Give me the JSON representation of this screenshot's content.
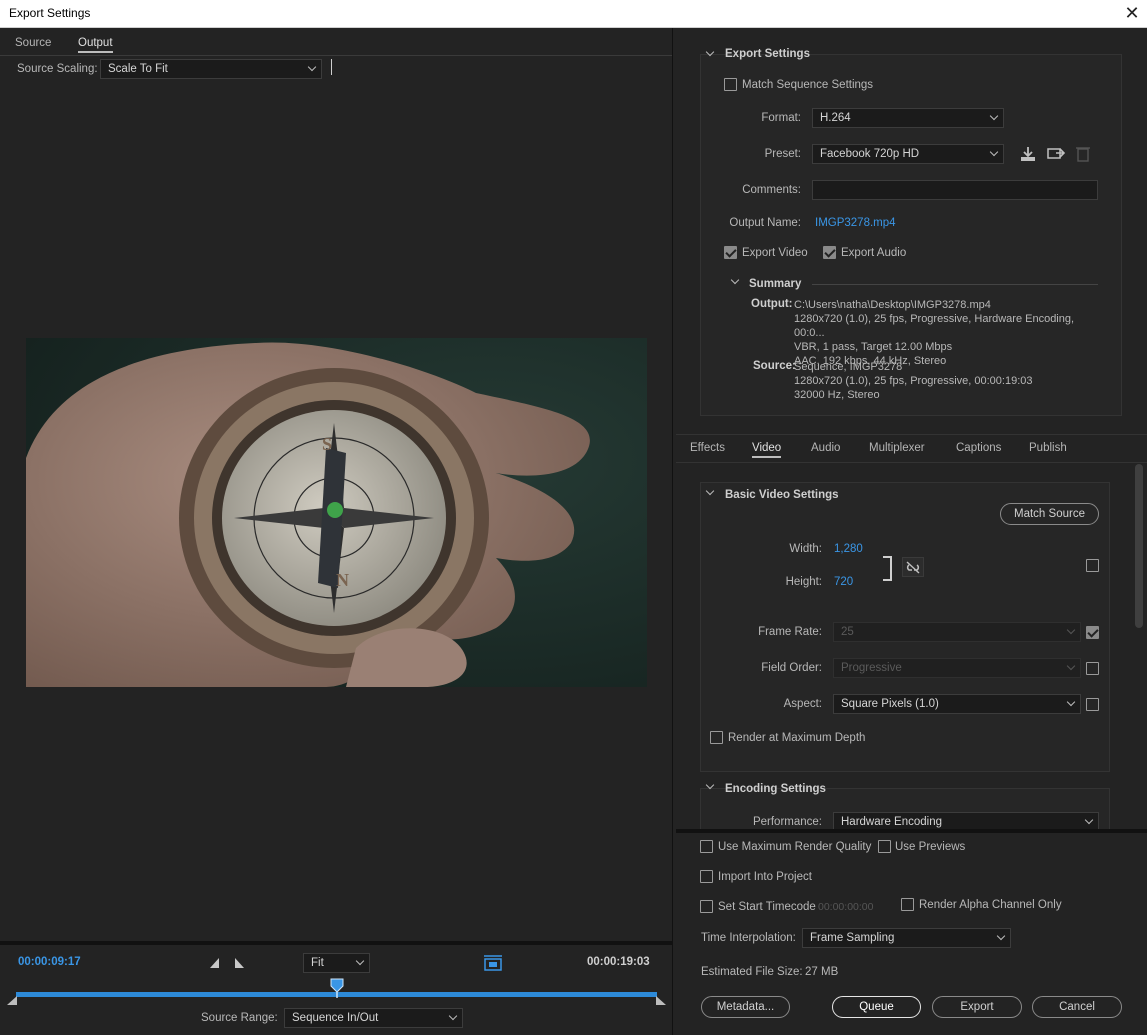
{
  "window": {
    "title": "Export Settings",
    "close": "✕"
  },
  "left": {
    "tabs": [
      "Source",
      "Output"
    ],
    "source_scaling_label": "Source Scaling:",
    "source_scaling_value": "Scale To Fit",
    "timecode_current": "00:00:09:17",
    "timecode_end": "00:00:19:03",
    "zoom_value": "Fit",
    "playhead_fraction": 0.5,
    "source_range_label": "Source Range:",
    "source_range_value": "Sequence In/Out"
  },
  "export_settings": {
    "header": "Export Settings",
    "match_sequence": "Match Sequence Settings",
    "format_label": "Format:",
    "format_value": "H.264",
    "preset_label": "Preset:",
    "preset_value": "Facebook 720p HD",
    "comments_label": "Comments:",
    "comments_value": "",
    "output_name_label": "Output Name:",
    "output_name_value": "IMGP3278.mp4",
    "export_video": "Export Video",
    "export_audio": "Export Audio",
    "summary_header": "Summary",
    "output_label": "Output:",
    "output_lines": [
      "C:\\Users\\natha\\Desktop\\IMGP3278.mp4",
      "1280x720 (1.0), 25 fps, Progressive, Hardware Encoding, 00:0...",
      "VBR, 1 pass, Target 12.00 Mbps",
      "AAC, 192 kbps, 44 kHz, Stereo"
    ],
    "source_label": "Source:",
    "source_lines": [
      "Sequence, IMGP3278",
      "1280x720 (1.0), 25 fps, Progressive, 00:00:19:03",
      "32000 Hz, Stereo"
    ]
  },
  "settings_tabs": [
    "Effects",
    "Video",
    "Audio",
    "Multiplexer",
    "Captions",
    "Publish"
  ],
  "video": {
    "basic_header": "Basic Video Settings",
    "match_source": "Match Source",
    "width_label": "Width:",
    "width_value": "1,280",
    "height_label": "Height:",
    "height_value": "720",
    "frame_rate_label": "Frame Rate:",
    "frame_rate_value": "25",
    "field_order_label": "Field Order:",
    "field_order_value": "Progressive",
    "aspect_label": "Aspect:",
    "aspect_value": "Square Pixels (1.0)",
    "render_max_depth": "Render at Maximum Depth",
    "encoding_header": "Encoding Settings",
    "performance_label": "Performance:",
    "performance_value": "Hardware Encoding"
  },
  "bottom": {
    "use_max_quality": "Use Maximum Render Quality",
    "use_previews": "Use Previews",
    "import_project": "Import Into Project",
    "set_start_timecode": "Set Start Timecode",
    "start_timecode_value": "00:00:00:00",
    "render_alpha": "Render Alpha Channel Only",
    "time_interp_label": "Time Interpolation:",
    "time_interp_value": "Frame Sampling",
    "file_size_label": "Estimated File Size:",
    "file_size_value": "27 MB",
    "metadata_btn": "Metadata...",
    "queue_btn": "Queue",
    "export_btn": "Export",
    "cancel_btn": "Cancel"
  }
}
